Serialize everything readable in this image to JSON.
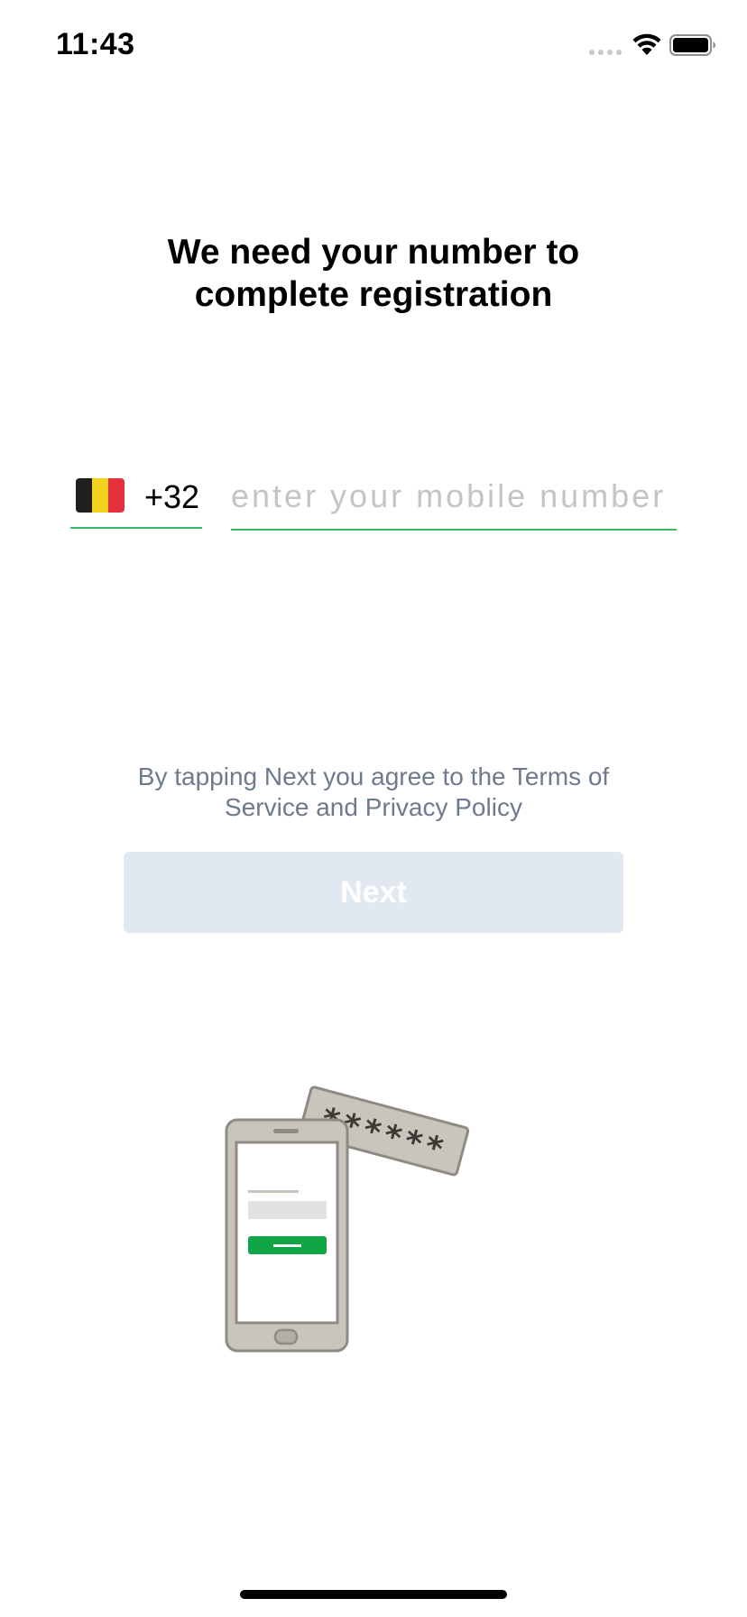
{
  "status_bar": {
    "time": "11:43",
    "icons": [
      "signal-dots-icon",
      "wifi-icon",
      "battery-icon"
    ]
  },
  "registration": {
    "title_line1": "We need your number to",
    "title_line2": "complete registration"
  },
  "phone_entry": {
    "country_flag": "belgium-flag-icon",
    "flag_colors": [
      "#1f1f1f",
      "#f5cf1d",
      "#e4303f"
    ],
    "country_code": "+32",
    "number_value": "",
    "number_placeholder": "enter your mobile number",
    "underline_color": "#3eb96c"
  },
  "terms": {
    "line1": "By tapping Next you agree to the Terms of",
    "line2": "Service and Privacy Policy"
  },
  "actions": {
    "next_label": "Next",
    "next_enabled": false,
    "next_bg_color": "#e1e8f0"
  },
  "illustration": {
    "code_text": "******",
    "icon": "phone-verification-illustration",
    "accent_color": "#10a646"
  }
}
